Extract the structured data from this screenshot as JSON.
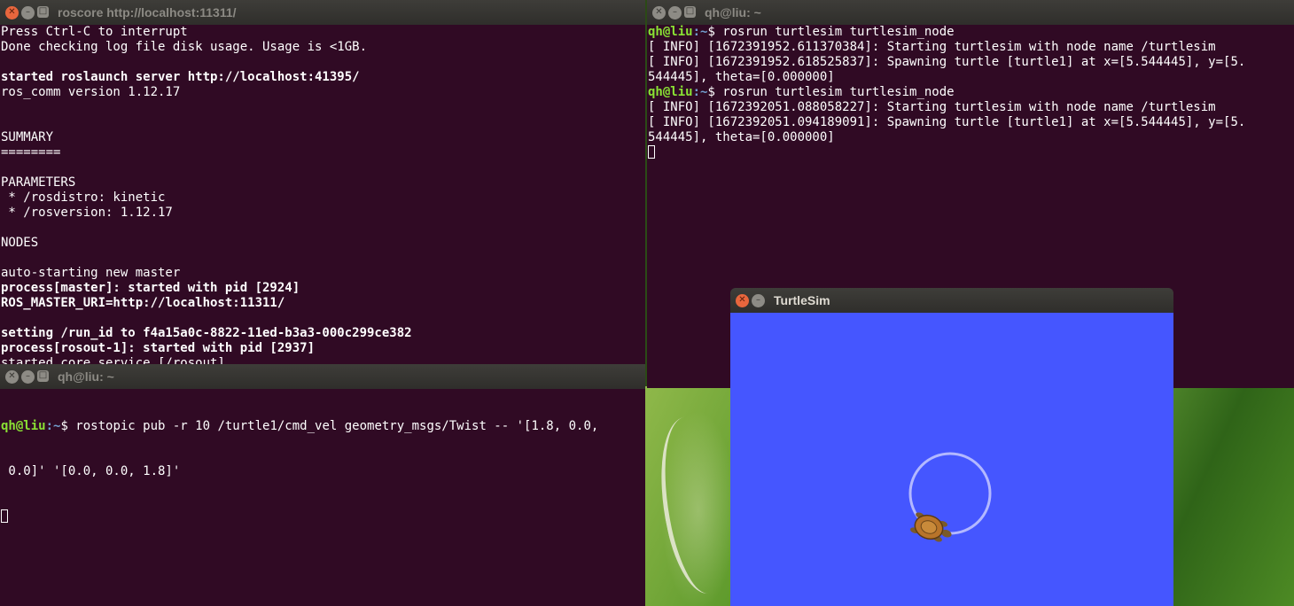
{
  "windows": {
    "roscore": {
      "title": "roscore http://localhost:11311/",
      "lines": [
        {
          "text": "Press Ctrl-C to interrupt",
          "bold": false
        },
        {
          "text": "Done checking log file disk usage. Usage is <1GB.",
          "bold": false
        },
        {
          "text": "",
          "bold": false
        },
        {
          "text": "started roslaunch server http://localhost:41395/",
          "bold": true
        },
        {
          "text": "ros_comm version 1.12.17",
          "bold": false
        },
        {
          "text": "",
          "bold": false
        },
        {
          "text": "",
          "bold": false
        },
        {
          "text": "SUMMARY",
          "bold": false
        },
        {
          "text": "========",
          "bold": false
        },
        {
          "text": "",
          "bold": false
        },
        {
          "text": "PARAMETERS",
          "bold": false
        },
        {
          "text": " * /rosdistro: kinetic",
          "bold": false
        },
        {
          "text": " * /rosversion: 1.12.17",
          "bold": false
        },
        {
          "text": "",
          "bold": false
        },
        {
          "text": "NODES",
          "bold": false
        },
        {
          "text": "",
          "bold": false
        },
        {
          "text": "auto-starting new master",
          "bold": false
        },
        {
          "text": "process[master]: started with pid [2924]",
          "bold": true
        },
        {
          "text": "ROS_MASTER_URI=http://localhost:11311/",
          "bold": true
        },
        {
          "text": "",
          "bold": false
        },
        {
          "text": "setting /run_id to f4a15a0c-8822-11ed-b3a3-000c299ce382",
          "bold": true
        },
        {
          "text": "process[rosout-1]: started with pid [2937]",
          "bold": true
        },
        {
          "text": "started core service [/rosout]",
          "bold": false
        }
      ]
    },
    "turtlesim_terminal": {
      "title": "qh@liu: ~",
      "lines": [
        {
          "type": "prompt",
          "user": "qh@liu",
          "path": ":~",
          "cmd": "$ rosrun turtlesim turtlesim_node"
        },
        {
          "type": "text",
          "text": "[ INFO] [1672391952.611370384]: Starting turtlesim with node name /turtlesim"
        },
        {
          "type": "text",
          "text": "[ INFO] [1672391952.618525837]: Spawning turtle [turtle1] at x=[5.544445], y=[5."
        },
        {
          "type": "text",
          "text": "544445], theta=[0.000000]"
        },
        {
          "type": "prompt",
          "user": "qh@liu",
          "path": ":~",
          "cmd": "$ rosrun turtlesim turtlesim_node"
        },
        {
          "type": "text",
          "text": "[ INFO] [1672392051.088058227]: Starting turtlesim with node name /turtlesim"
        },
        {
          "type": "text",
          "text": "[ INFO] [1672392051.094189091]: Spawning turtle [turtle1] at x=[5.544445], y=[5."
        },
        {
          "type": "text",
          "text": "544445], theta=[0.000000]"
        }
      ]
    },
    "rostopic_terminal": {
      "title": "qh@liu: ~",
      "user": "qh@liu",
      "path": ":~",
      "cmd": "$ rostopic pub -r 10 /turtle1/cmd_vel geometry_msgs/Twist -- '[1.8, 0.0,",
      "cmd_cont": " 0.0]' '[0.0, 0.0, 1.8]'"
    },
    "turtlesim": {
      "title": "TurtleSim",
      "background_color": "#4556ff",
      "path_color": "#b3b8ff"
    }
  },
  "icons": [
    "close-icon",
    "minimize-icon",
    "maximize-icon",
    "turtle-icon"
  ]
}
